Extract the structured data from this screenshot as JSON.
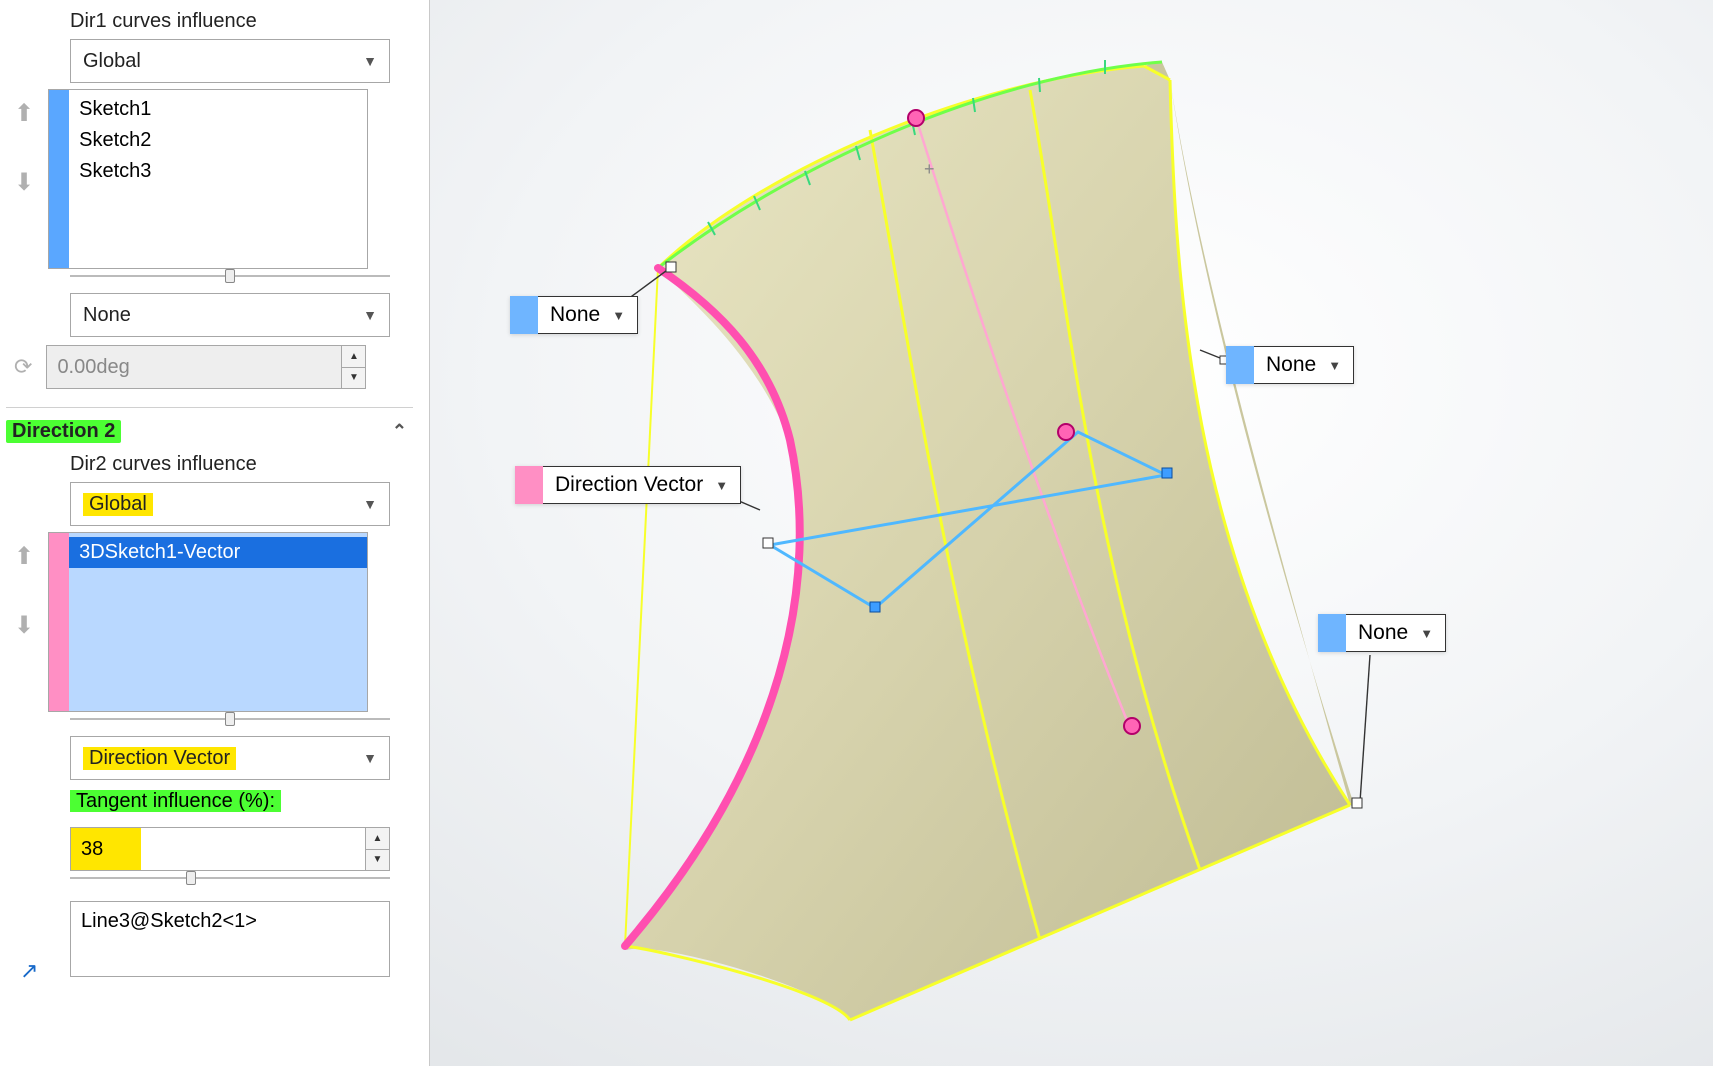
{
  "panel": {
    "dir1": {
      "label": "Dir1 curves influence",
      "influence_dropdown": "Global",
      "sketches": [
        "Sketch1",
        "Sketch2",
        "Sketch3"
      ],
      "tangent_type": "None",
      "draft_angle": "0.00deg"
    },
    "dir2": {
      "heading": "Direction 2",
      "label": "Dir2 curves influence",
      "influence_dropdown": "Global",
      "sketches": [
        "3DSketch1-Vector"
      ],
      "tangent_type": "Direction Vector",
      "tangent_influence_label": "Tangent influence (%):",
      "tangent_influence_value": "38",
      "vector_ref": "Line3@Sketch2<1>"
    }
  },
  "callouts": {
    "c1": "None",
    "c2": "Direction Vector",
    "c3": "None",
    "c4": "None"
  }
}
